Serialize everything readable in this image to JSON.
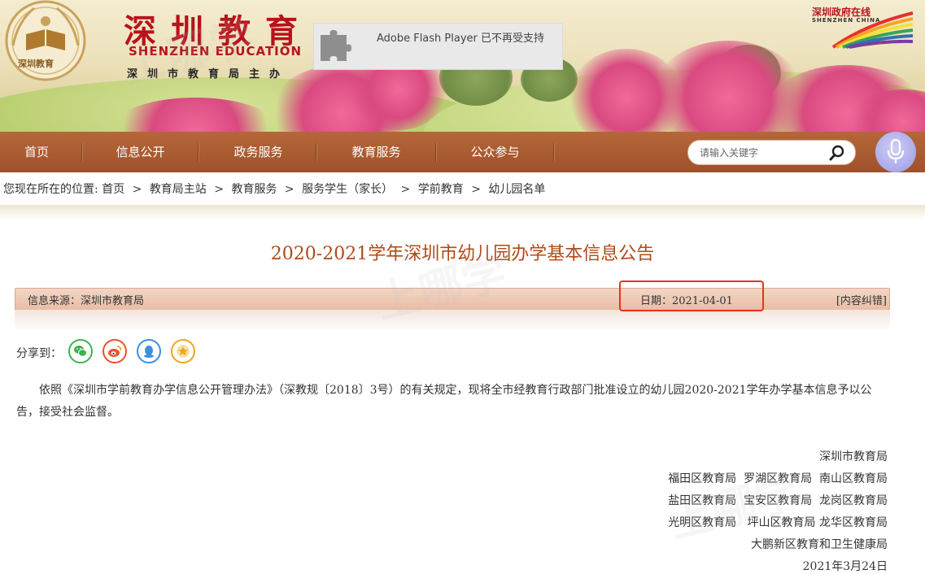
{
  "header": {
    "logo_title": "深圳教育",
    "logo_en": "SHENZHEN EDUCATION",
    "logo_sub": "深圳市教育局主办",
    "emblem_text": "深圳教育",
    "flash_message": "Adobe Flash Player 已不再受支持",
    "china_logo_cn": "深圳政府在线",
    "china_logo_en": "SHENZHEN CHINA"
  },
  "nav": {
    "items": [
      {
        "label": "首页"
      },
      {
        "label": "信息公开"
      },
      {
        "label": "政务服务"
      },
      {
        "label": "教育服务"
      },
      {
        "label": "公众参与"
      }
    ],
    "search_placeholder": "请输入关键字",
    "search_icon": "search-icon",
    "voice_icon": "microphone-icon"
  },
  "breadcrumb": {
    "prefix": "您现在所在的位置:",
    "items": [
      "首页",
      "教育局主站",
      "教育服务",
      "服务学生（家长）",
      "学前教育",
      "幼儿园名单"
    ],
    "separator": ">"
  },
  "article": {
    "title": "2020-2021学年深圳市幼儿园办学基本信息公告",
    "source": "信息来源：深圳市教育局",
    "date": "日期：2021-04-01",
    "correction": "[内容纠错]",
    "share_label": "分享到：",
    "share_icons": [
      "wechat-icon",
      "weibo-icon",
      "qq-icon",
      "favorite-icon"
    ],
    "body": "依照《深圳市学前教育办学信息公开管理办法》（深教规〔2018〕3号）的有关规定，现将全市经教育行政部门批准设立的幼儿园2020-2021学年办学基本信息予以公告，接受社会监督。",
    "signature": [
      "深圳市教育局",
      "福田区教育局  罗湖区教育局  南山区教育局",
      "盐田区教育局  宝安区教育局  龙岗区教育局",
      "光明区教育局   坪山区教育局 龙华区教育局",
      "大鹏新区教育和卫生健康局",
      "2021年3月24日"
    ]
  },
  "colors": {
    "nav_bg": "#a85a30",
    "title": "#b04a19",
    "highlight": "#e2351e",
    "logo_red": "#b8121c"
  }
}
